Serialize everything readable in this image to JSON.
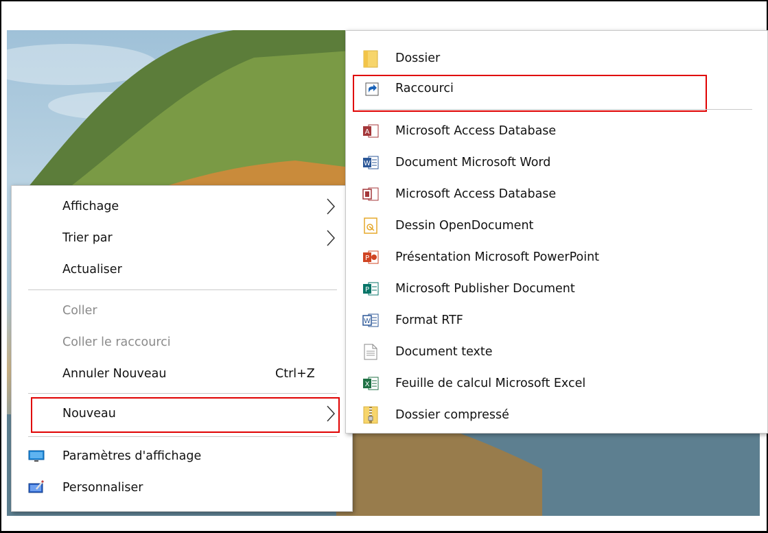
{
  "context_menu": {
    "items": [
      {
        "label": "Affichage",
        "submenu": true
      },
      {
        "label": "Trier par",
        "submenu": true
      },
      {
        "label": "Actualiser"
      },
      {
        "label": "Coller",
        "disabled": true
      },
      {
        "label": "Coller le raccourci",
        "disabled": true
      },
      {
        "label": "Annuler Nouveau",
        "shortcut": "Ctrl+Z"
      },
      {
        "label": "Nouveau",
        "submenu": true,
        "highlighted": true
      },
      {
        "label": "Paramètres d'affichage",
        "icon": "display-settings-icon"
      },
      {
        "label": "Personnaliser",
        "icon": "personalize-icon"
      }
    ]
  },
  "submenu_nouveau": {
    "items": [
      {
        "label": "Dossier",
        "icon": "folder-icon"
      },
      {
        "label": "Raccourci",
        "icon": "shortcut-icon",
        "highlighted": true
      },
      {
        "label": "Microsoft Access Database",
        "icon": "access-icon"
      },
      {
        "label": "Document Microsoft Word",
        "icon": "word-icon"
      },
      {
        "label": "Microsoft Access Database",
        "icon": "access-alt-icon"
      },
      {
        "label": "Dessin OpenDocument",
        "icon": "odg-icon"
      },
      {
        "label": "Présentation Microsoft PowerPoint",
        "icon": "powerpoint-icon"
      },
      {
        "label": "Microsoft Publisher Document",
        "icon": "publisher-icon"
      },
      {
        "label": "Format RTF",
        "icon": "rtf-icon"
      },
      {
        "label": "Document texte",
        "icon": "text-document-icon"
      },
      {
        "label": "Feuille de calcul Microsoft Excel",
        "icon": "excel-icon"
      },
      {
        "label": "Dossier compressé",
        "icon": "zip-folder-icon"
      }
    ]
  },
  "colors": {
    "highlight_border": "#e00000",
    "menu_bg": "#ffffff",
    "disabled_text": "#8a8a8a"
  }
}
